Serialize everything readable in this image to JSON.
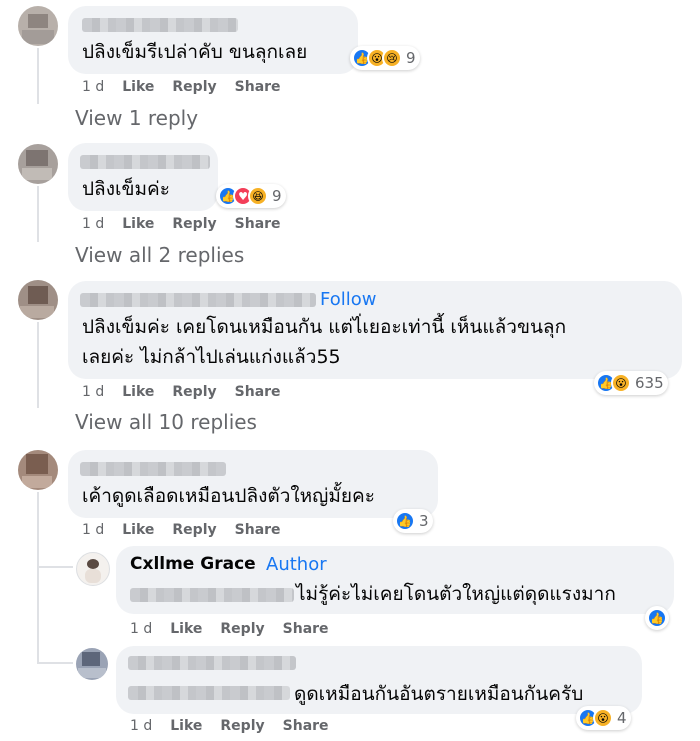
{
  "comments": [
    {
      "text": "ปลิงเข็มรีเปล่าคับ ขนลุกเลย",
      "reaction_count": "9",
      "reactions": [
        "like-icon",
        "wow-icon",
        "sad-icon"
      ]
    },
    {
      "text": "ปลิงเข็มค่ะ",
      "reaction_count": "9",
      "reactions": [
        "like-icon",
        "heart-icon",
        "haha-icon"
      ]
    },
    {
      "text_line1": "ปลิงเข็มค่ะ เคยโดนเหมือนกัน แต่ไ่เยอะเท่านี้ เห็นแล้วขนลุก",
      "text_line2": "เลยค่ะ ไม่กล้าไปเล่นแก่งแล้ว55",
      "follow": "Follow",
      "reaction_count": "635",
      "reactions": [
        "like-icon",
        "wow-icon"
      ]
    },
    {
      "text": "เค้าดูดเลือดเหมือนปลิงตัวใหญ่มั้ยคะ",
      "reaction_count": "3",
      "reactions": [
        "like-icon"
      ]
    }
  ],
  "replies": [
    {
      "name": "Cxllme Grace",
      "badge": "Author",
      "text": "ไม่รู้ค่ะไม่เคยโดนตัวใหญ่แต่ดุดแรงมาก",
      "reactions": [
        "like-icon"
      ]
    },
    {
      "text": "ดูดเหมือนกันอันตรายเหมือนกันครับ",
      "reaction_count": "4",
      "reactions": [
        "like-icon",
        "wow-icon"
      ]
    }
  ],
  "actions": {
    "time": "1 d",
    "like": "Like",
    "reply": "Reply",
    "share": "Share"
  },
  "view_replies": [
    "View 1 reply",
    "View all 2 replies",
    "View all 10 replies"
  ],
  "colors": {
    "bubble": "#f0f2f5",
    "muted": "#65676b",
    "accent": "#1877f2"
  }
}
